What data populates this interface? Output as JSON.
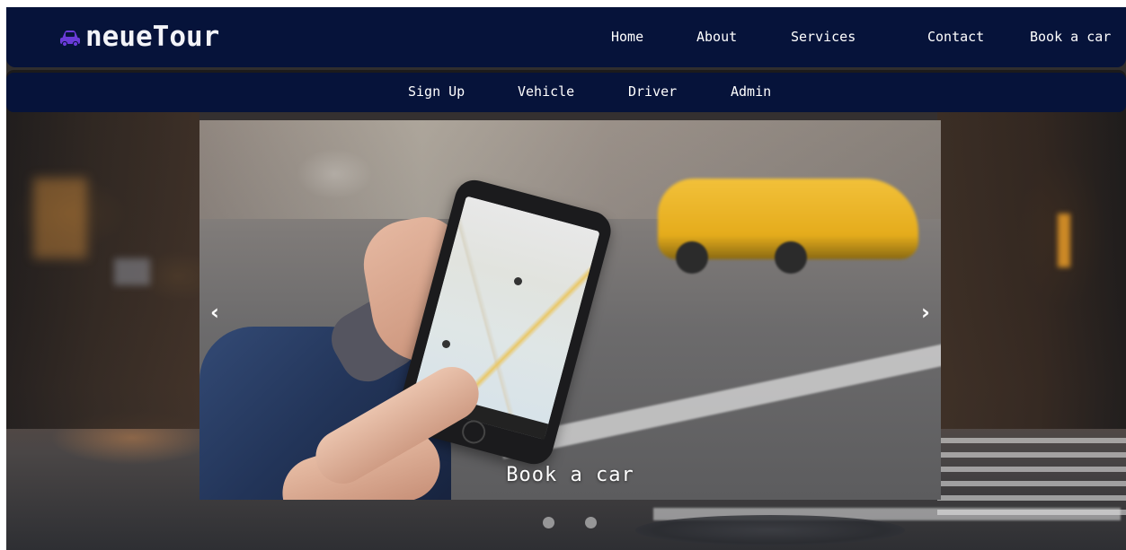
{
  "brand": {
    "name": "neueTour",
    "icon": "car-icon",
    "icon_color": "#6a3bd8"
  },
  "nav_main": {
    "items": [
      {
        "label": "Home"
      },
      {
        "label": "About"
      },
      {
        "label": "Services"
      },
      {
        "label": "Contact"
      },
      {
        "label": "Book a car"
      }
    ]
  },
  "nav_sub": {
    "items": [
      {
        "label": "Sign Up"
      },
      {
        "label": "Vehicle"
      },
      {
        "label": "Driver"
      },
      {
        "label": "Admin"
      }
    ]
  },
  "carousel": {
    "slide_caption": "Book a car",
    "prev_icon": "chevron-left-icon",
    "next_icon": "chevron-right-icon",
    "prev_glyph": "‹",
    "next_glyph": "›",
    "indicator_count": 2
  },
  "colors": {
    "navbar_bg": "#06133a",
    "nav_text": "#ffffff"
  }
}
